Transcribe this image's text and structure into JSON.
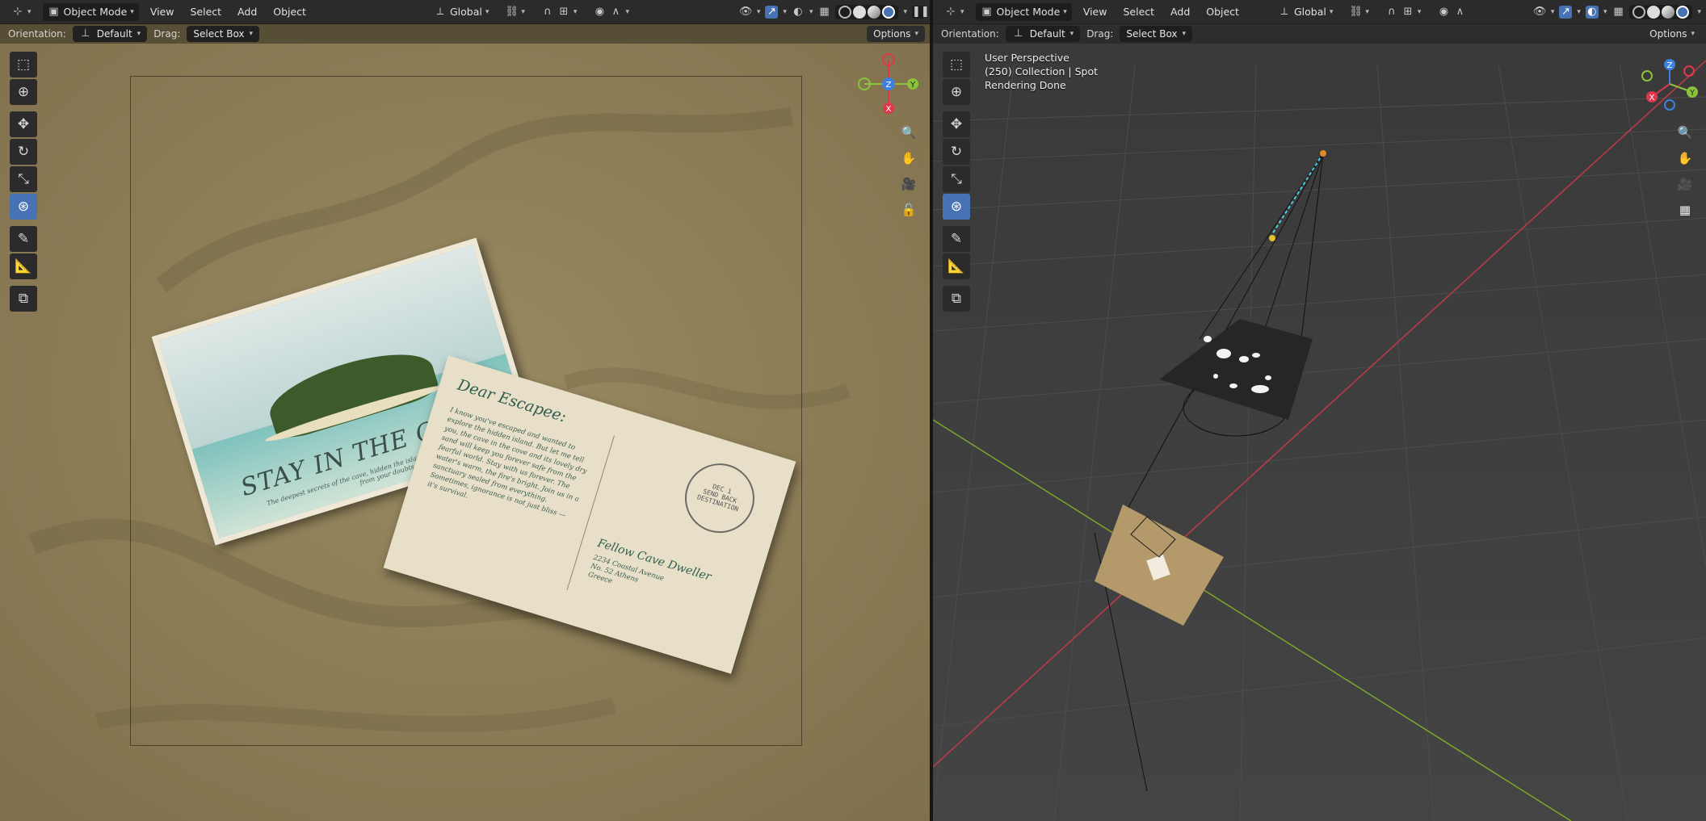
{
  "left_viewport": {
    "header": {
      "editor_type_icon": "axis-icon",
      "mode": "Object Mode",
      "menus": [
        "View",
        "Select",
        "Add",
        "Object"
      ],
      "transform_orientation": "Global"
    },
    "tool_settings": {
      "orientation_label": "Orientation:",
      "orientation_value": "Default",
      "drag_label": "Drag:",
      "drag_value": "Select Box",
      "options_label": "Options"
    },
    "gizmo": {
      "z": "Z",
      "y": "Y",
      "x": "X"
    },
    "render": {
      "front": {
        "title": "STAY IN THE CAVE",
        "subtitle": "The deepest secrets of the cave, hidden the island's shores that begin to lift from your doubts."
      },
      "back": {
        "greeting": "Dear Escapee:",
        "body": "I know you've escaped and wanted to explore the hidden island. But let me tell you, the cave in the cove and its lovely dry sand will keep you forever safe from the fearful world. Stay with us forever. The water's warm, the fire's bright. Join us in a sanctuary sealed from everything. Sometimes, ignorance is not just bliss — it's survival.",
        "postmark": "DEC 1\nSEND BACK\nDESTINATION",
        "to": "Fellow Cave Dweller",
        "address": "2234 Coastal Avenue\nNo. 52 Athens\nGreece"
      }
    }
  },
  "right_viewport": {
    "header": {
      "editor_type_icon": "axis-icon",
      "mode": "Object Mode",
      "menus": [
        "View",
        "Select",
        "Add",
        "Object"
      ],
      "transform_orientation": "Global"
    },
    "tool_settings": {
      "orientation_label": "Orientation:",
      "orientation_value": "Default",
      "drag_label": "Drag:",
      "drag_value": "Select Box",
      "options_label": "Options"
    },
    "overlay": {
      "perspective": "User Perspective",
      "collection": "(250) Collection | Spot",
      "status": "Rendering Done"
    },
    "gizmo": {
      "z": "Z",
      "y": "Y",
      "x": "X"
    }
  },
  "colors": {
    "header_bg": "#2b2b2b",
    "active_blue": "#4772b3",
    "axis_x": "#e0374d",
    "axis_y": "#8ac23a",
    "axis_z": "#3d80e0",
    "sand": "#8a7a54"
  },
  "toolbar_icons": [
    "select-box-icon",
    "cursor-icon",
    "move-icon",
    "rotate-icon",
    "scale-icon",
    "transform-icon",
    "annotate-icon",
    "measure-icon",
    "add-cube-icon"
  ]
}
